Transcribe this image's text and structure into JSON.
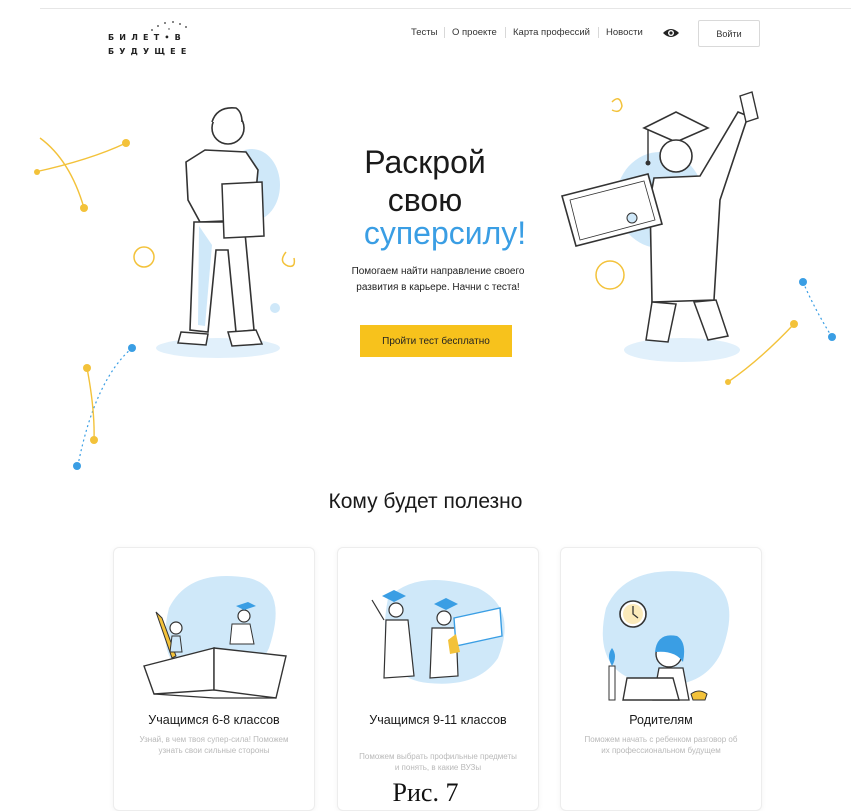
{
  "header": {
    "logo_row1": "БИЛЕТ•В",
    "logo_row2": "БУДУЩЕЕ",
    "nav": [
      {
        "label": "Тесты"
      },
      {
        "label": "О проекте"
      },
      {
        "label": "Карта профессий"
      },
      {
        "label": "Новости"
      }
    ],
    "accessibility_icon": "eye-icon",
    "login_label": "Войти"
  },
  "hero": {
    "title_line1": "Раскрой",
    "title_line2": "свою",
    "title_accent": "суперсилу!",
    "subtitle_line1": "Помогаем найти направление своего",
    "subtitle_line2": "развития в карьере. Начни с теста!",
    "cta_label": "Пройти тест бесплатно"
  },
  "audience": {
    "title": "Кому будет полезно",
    "cards": [
      {
        "title": "Учащимся 6-8 классов",
        "text": "Узнай, в чем твоя супер-сила! Поможем узнать свои сильные стороны"
      },
      {
        "title": "Учащимся 9-11 классов",
        "text": "Поможем выбрать профильные предметы и понять, в какие ВУЗы"
      },
      {
        "title": "Родителям",
        "text": "Поможем начать с ребенком разговор об их профессиональном будущем"
      }
    ]
  },
  "caption": "Рис. 7",
  "colors": {
    "accent_blue": "#3a9ee4",
    "cta_yellow": "#f7c21c",
    "illustration_blue": "#cfe8f9"
  }
}
